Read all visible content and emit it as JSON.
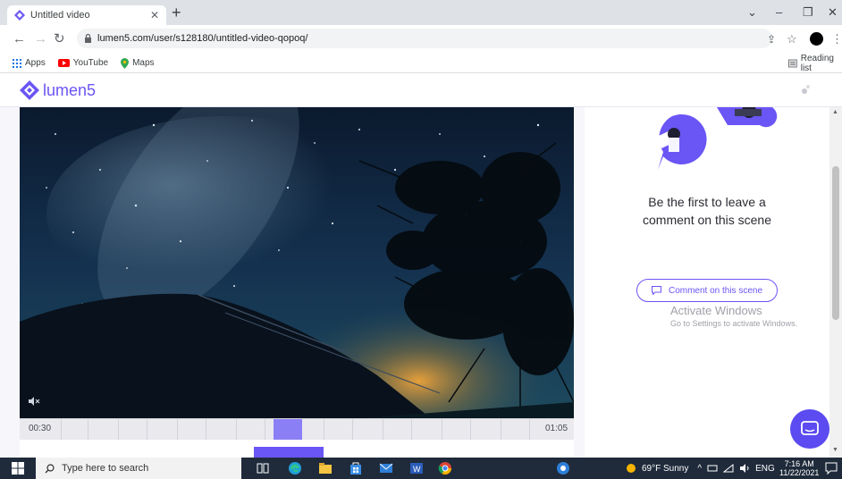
{
  "browser": {
    "tab_title": "Untitled video",
    "url": "lumen5.com/user/s128180/untitled-video-qopoq/",
    "bookmarks": [
      "Apps",
      "YouTube",
      "Maps"
    ],
    "reading_list": "Reading list"
  },
  "app": {
    "logo_text": "lumen5",
    "brand_color": "#6a55f5"
  },
  "timeline": {
    "start_time": "00:30",
    "end_time": "01:05"
  },
  "comments": {
    "prompt_line1": "Be the first to leave a",
    "prompt_line2": "comment on this scene",
    "button_label": "Comment on this scene"
  },
  "watermark": {
    "line1": "Activate Windows",
    "line2": "Go to Settings to activate Windows."
  },
  "taskbar": {
    "search_placeholder": "Type here to search",
    "weather": "69°F  Sunny",
    "language": "ENG",
    "time": "7:16 AM",
    "date": "11/22/2021"
  }
}
